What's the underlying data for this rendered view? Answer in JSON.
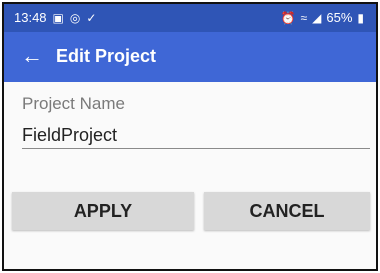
{
  "status_bar": {
    "time": "13:48",
    "battery": "65%",
    "left_icons": [
      "image-icon",
      "camera-icon",
      "check-circle-icon"
    ],
    "right_icons": [
      "alarm-icon",
      "wifi-icon",
      "signal-icon",
      "battery-icon"
    ]
  },
  "app_bar": {
    "title": "Edit Project",
    "back_icon": "arrow-left-icon",
    "color": "#3f67d6"
  },
  "form": {
    "project_name_label": "Project Name",
    "project_name_value": "FieldProject"
  },
  "buttons": {
    "apply_label": "APPLY",
    "cancel_label": "CANCEL"
  }
}
